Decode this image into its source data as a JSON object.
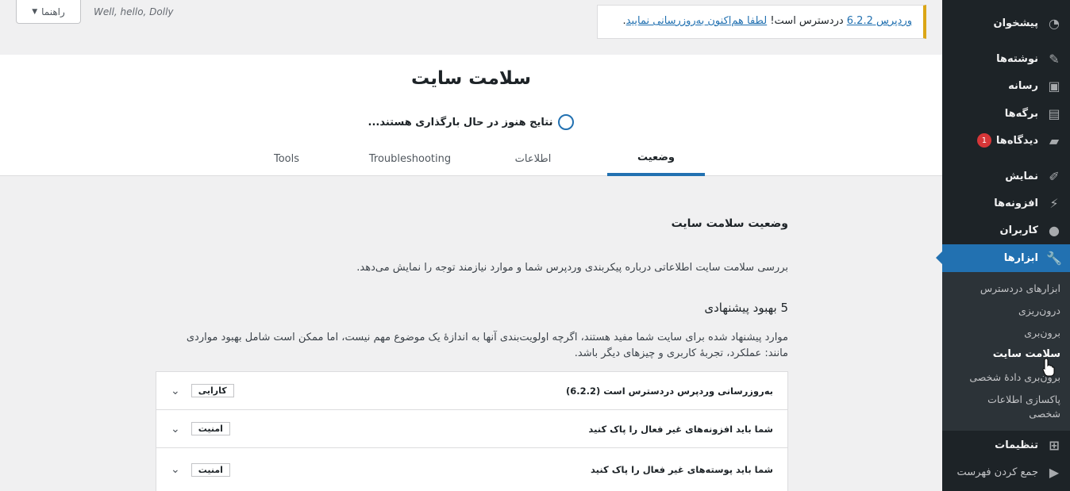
{
  "topbar": {
    "help_label": "راهنما",
    "dolly_text": "Well, hello, Dolly",
    "notice": {
      "link1": "وردپرس 6.2.2",
      "middle": " دردسترس است! ",
      "link2": "لطفا هم‌اکنون به‌روزرسانی نمایید",
      "end": "."
    }
  },
  "header": {
    "title": "سلامت سایت",
    "loading_text": "نتایج هنوز در حال بارگذاری هستند...",
    "tabs": [
      {
        "label": "وضعیت"
      },
      {
        "label": "اطلاعات"
      },
      {
        "label": "Troubleshooting"
      },
      {
        "label": "Tools"
      }
    ]
  },
  "content": {
    "section_title": "وضعیت سلامت سایت",
    "section_desc": "بررسی سلامت سایت اطلاعاتی درباره پیکربندی وردپرس شما و موارد نیازمند توجه را نمایش می‌دهد.",
    "improve_count": "5 بهبود پیشنهادی",
    "improve_desc": "موارد پیشنهاد شده برای سایت شما مفید هستند، اگرچه اولویت‌بندی آنها به اندازهٔ یک موضوع مهم نیست، اما ممکن است شامل بهبود مواردی مانند: عملکرد، تجربهٔ کاربری و چیزهای دیگر باشد.",
    "items": [
      {
        "title": "به‌روزرسانی وردپرس دردسترس است (6.2.2)",
        "badge": "کارایی"
      },
      {
        "title": "شما باید افزونه‌های غیر فعال را پاک کنید",
        "badge": "امنیت"
      },
      {
        "title": "شما باید پوسته‌های غیر فعال را پاک کنید",
        "badge": "امنیت"
      }
    ]
  },
  "sidebar": {
    "items": [
      {
        "label": "پیشخوان",
        "icon": "dashboard-icon"
      },
      {
        "label": "نوشته‌ها",
        "icon": "pin-icon"
      },
      {
        "label": "رسانه",
        "icon": "media-icon"
      },
      {
        "label": "برگه‌ها",
        "icon": "pages-icon"
      },
      {
        "label": "دیدگاه‌ها",
        "icon": "comments-icon",
        "badge": "1"
      },
      {
        "label": "نمایش",
        "icon": "appearance-icon"
      },
      {
        "label": "افزونه‌ها",
        "icon": "plugins-icon"
      },
      {
        "label": "کاربران",
        "icon": "users-icon"
      },
      {
        "label": "ابزارها",
        "icon": "tools-icon"
      },
      {
        "label": "تنظیمات",
        "icon": "settings-icon"
      },
      {
        "label": "جمع کردن فهرست",
        "icon": "collapse-icon"
      }
    ],
    "submenu": [
      {
        "label": "ابزارهای دردسترس"
      },
      {
        "label": "درون‌ریزی"
      },
      {
        "label": "برون‌بری"
      },
      {
        "label": "سلامت سایت"
      },
      {
        "label": "برون‌بری دادهٔ شخصی"
      },
      {
        "label": "پاکسازی اطلاعات شخصی"
      }
    ]
  },
  "colors": {
    "accent": "#2271b1",
    "sidebar_bg": "#1d2327",
    "notice_border": "#dba617",
    "badge_red": "#d63638"
  }
}
